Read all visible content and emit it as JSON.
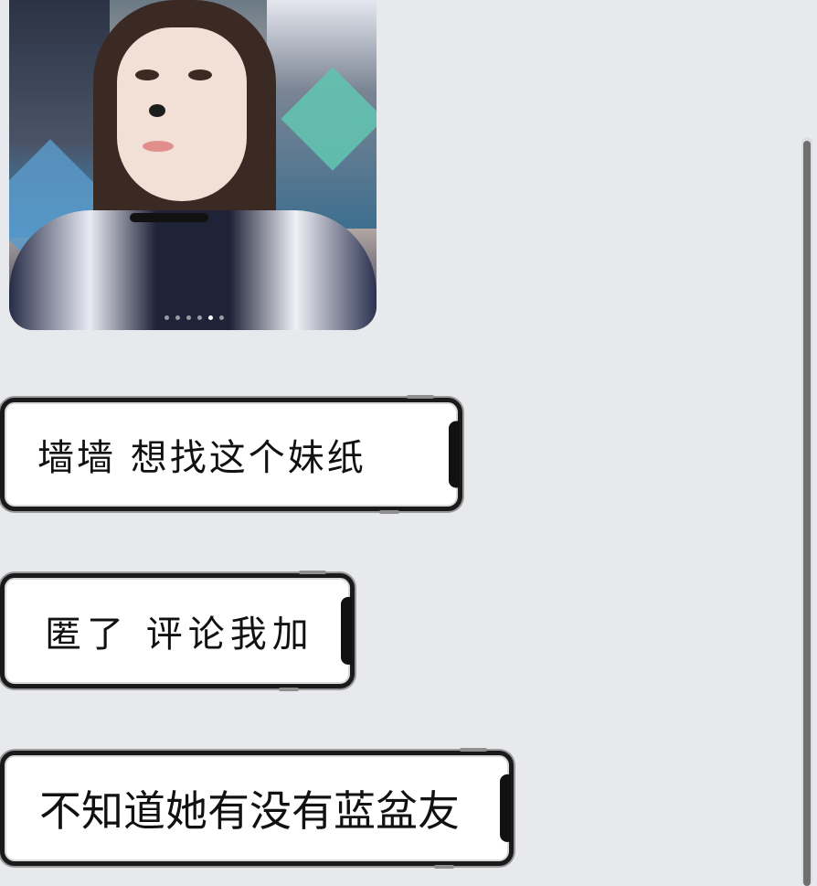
{
  "photo": {
    "carousel_count": 6,
    "carousel_active_index": 4
  },
  "messages": [
    {
      "text": "墙墙  想找这个妹纸"
    },
    {
      "text": "匿了 评论我加"
    },
    {
      "text": "不知道她有没有蓝盆友"
    }
  ],
  "colors": {
    "background": "#e8e9ed",
    "bubble": "#ffffff",
    "frame": "#1a1a1a"
  }
}
